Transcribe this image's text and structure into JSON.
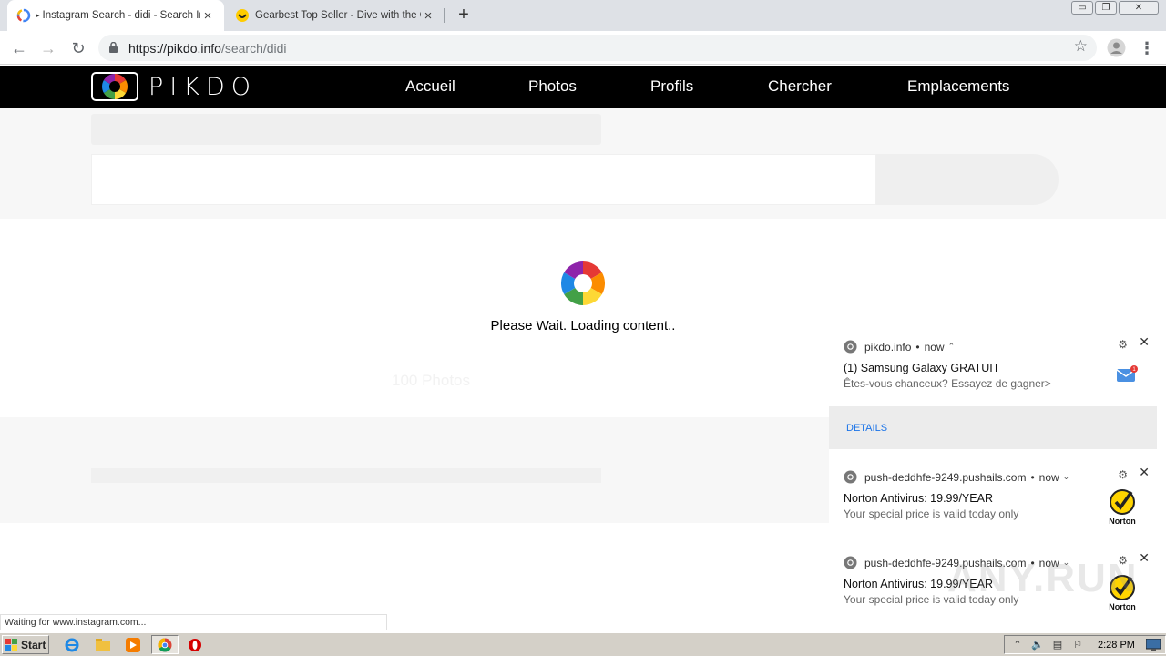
{
  "browser": {
    "tabs": [
      {
        "title": "Instagram Search - didi - Search In",
        "icon": "loading-favicon-icon",
        "active": true
      },
      {
        "title": "Gearbest Top Seller - Dive with the C",
        "icon": "gearbest-favicon-icon",
        "active": false
      }
    ],
    "new_tab": "+",
    "window_controls": {
      "minimize": "▭",
      "restore": "❐",
      "close": "✕"
    },
    "toolbar": {
      "back": "←",
      "forward": "→",
      "reload": "↻",
      "url_host": "https://pikdo.info",
      "url_path": "/search/didi",
      "star": "☆",
      "menu": "⋮"
    },
    "status_text": "Waiting for www.instagram.com..."
  },
  "site": {
    "logo_text": "PIKDO",
    "nav": [
      "Accueil",
      "Photos",
      "Profils",
      "Chercher",
      "Emplacements"
    ],
    "hidden_label": "100 Photos"
  },
  "loader": {
    "text": "Please Wait. Loading content.."
  },
  "notifications": [
    {
      "source": "pikdo.info",
      "time": "now",
      "caret": "⌃",
      "title": "(1) Samsung Galaxy GRATUIT",
      "body": "Êtes-vous chanceux? Essayez de gagner>",
      "action": "DETAILS",
      "image": "mail-badge-icon",
      "badge_count": "1"
    },
    {
      "source": "push-deddhfe-9249.pushails.com",
      "time": "now",
      "caret": "⌄",
      "title": "Norton Antivirus: 19.99/YEAR",
      "body": "Your special price is valid today only",
      "image": "norton-logo-icon",
      "image_label": "Norton"
    },
    {
      "source": "push-deddhfe-9249.pushails.com",
      "time": "now",
      "caret": "⌄",
      "title": "Norton Antivirus: 19.99/YEAR",
      "body": "Your special price is valid today only",
      "image": "norton-logo-icon",
      "image_label": "Norton"
    }
  ],
  "notification_bullet": "•",
  "taskbar": {
    "start_label": "Start",
    "clock": "2:28 PM"
  },
  "watermark": "ANY.RUN",
  "colors": {
    "nav_bg": "#000000",
    "tab_strip": "#dee1e6",
    "link_blue": "#1a73e8",
    "taskbar": "#d4d0c8"
  }
}
